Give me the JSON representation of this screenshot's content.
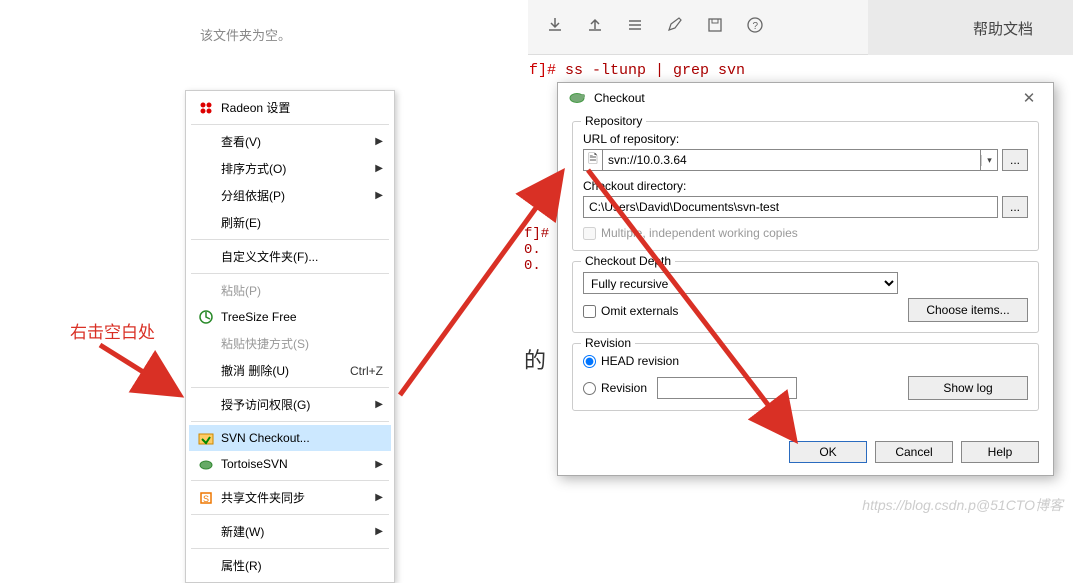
{
  "empty_folder_text": "该文件夹为空。",
  "annotation": "右击空白处",
  "context_menu": {
    "radeon": "Radeon 设置",
    "view": "查看(V)",
    "sort": "排序方式(O)",
    "group": "分组依据(P)",
    "refresh": "刷新(E)",
    "custom_folder": "自定义文件夹(F)...",
    "paste": "粘贴(P)",
    "treesize": "TreeSize Free",
    "paste_shortcut": "粘贴快捷方式(S)",
    "undo_delete": "撤消 删除(U)",
    "undo_shortcut": "Ctrl+Z",
    "grant_access": "授予访问权限(G)",
    "svn_checkout": "SVN Checkout...",
    "tortoise": "TortoiseSVN",
    "share_sync": "共享文件夹同步",
    "new": "新建(W)",
    "properties": "属性(R)"
  },
  "toolbar": {
    "help_panel": "帮助文档"
  },
  "terminal": {
    "prompt1": "f]# ",
    "cmd1": "ss -ltunp | grep svn",
    "bits_prompt": "f]#",
    "bits1": "0.",
    "bits2": "0."
  },
  "below_char": "的",
  "dialog": {
    "title": "Checkout",
    "repo_group": "Repository",
    "url_label": "URL of repository:",
    "url_value": "svn://10.0.3.64",
    "dir_label": "Checkout directory:",
    "dir_value": "C:\\Users\\David\\Documents\\svn-test",
    "multi_label": "Multiple, independent working copies",
    "depth_group": "Checkout Depth",
    "depth_value": "Fully recursive",
    "omit_label": "Omit externals",
    "choose_items": "Choose items...",
    "rev_group": "Revision",
    "head_label": "HEAD revision",
    "rev_label": "Revision",
    "show_log": "Show log",
    "ok": "OK",
    "cancel": "Cancel",
    "help": "Help",
    "browse": "..."
  },
  "watermark": "https://blog.csdn.p@51CTO博客"
}
